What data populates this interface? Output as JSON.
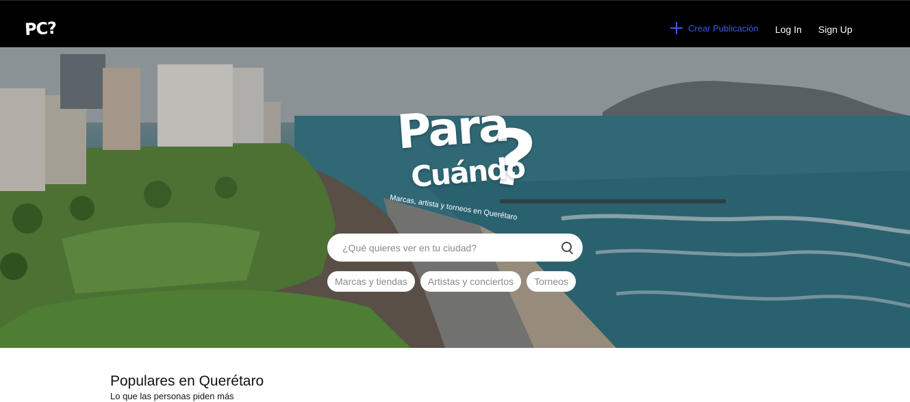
{
  "navbar": {
    "logo": "PC?",
    "create_label": "Crear Publicación",
    "login_label": "Log In",
    "signup_label": "Sign Up"
  },
  "hero": {
    "brand_line1": "Para",
    "brand_line2": "Cuándo",
    "brand_qmark": "?",
    "tagline": "Marcas, artista y torneos en Querétaro",
    "search_placeholder": "¿Qué quieres ver en tu ciudad?",
    "chips": [
      "Marcas y tiendas",
      "Artistas y conciertos",
      "Torneos"
    ]
  },
  "section": {
    "title": "Populares en Querétaro",
    "subtitle": "Lo que las personas piden más"
  },
  "colors": {
    "navbar_bg": "#000000",
    "accent": "#3d5af1",
    "white": "#ffffff"
  },
  "icons": [
    "plus-icon",
    "search-icon"
  ]
}
